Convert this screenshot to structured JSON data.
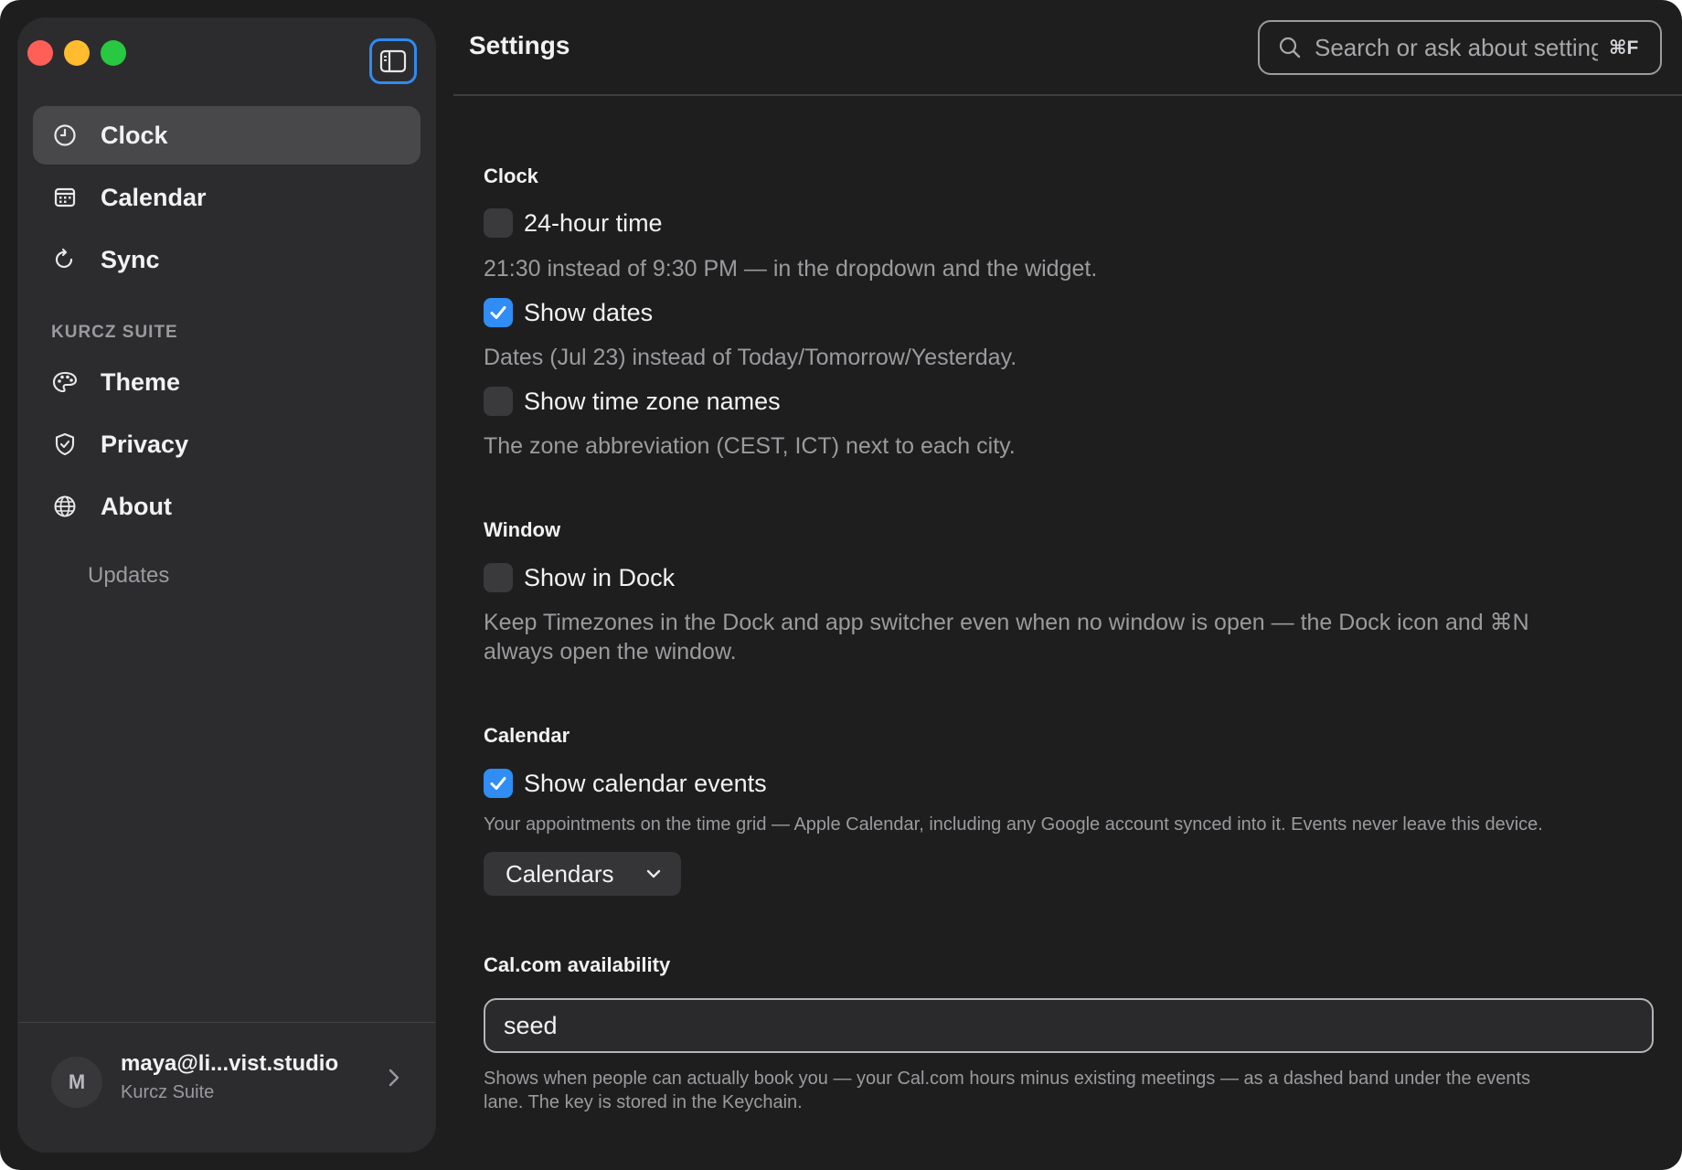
{
  "sidebar": {
    "nav": [
      {
        "label": "Clock",
        "icon": "clock-icon",
        "active": true
      },
      {
        "label": "Calendar",
        "icon": "calendar-icon",
        "active": false
      },
      {
        "label": "Sync",
        "icon": "sync-icon",
        "active": false
      }
    ],
    "section_label": "KURCZ SUITE",
    "suite_nav": [
      {
        "label": "Theme",
        "icon": "palette-icon"
      },
      {
        "label": "Privacy",
        "icon": "shield-check-icon"
      },
      {
        "label": "About",
        "icon": "globe-icon"
      }
    ],
    "sub_item": "Updates",
    "account": {
      "avatar_initial": "M",
      "email": "maya@li...vist.studio",
      "subtitle": "Kurcz Suite"
    }
  },
  "header": {
    "title": "Settings",
    "search_placeholder": "Search or ask about settings",
    "search_shortcut": "⌘F"
  },
  "clock": {
    "title": "Clock",
    "options": [
      {
        "label": "24-hour time",
        "checked": false,
        "description": "21:30 instead of 9:30 PM — in the dropdown and the widget."
      },
      {
        "label": "Show dates",
        "checked": true,
        "description": "Dates (Jul 23) instead of Today/Tomorrow/Yesterday."
      },
      {
        "label": "Show time zone names",
        "checked": false,
        "description": "The zone abbreviation (CEST, ICT) next to each city."
      }
    ]
  },
  "window": {
    "title": "Window",
    "options": [
      {
        "label": "Show in Dock",
        "checked": false,
        "description_line1": "Keep Timezones in the Dock and app switcher even when no window is open — the Dock icon and ⌘N",
        "description_line2": "always open the window."
      }
    ]
  },
  "calendar": {
    "title": "Calendar",
    "option": {
      "label": "Show calendar events",
      "checked": true,
      "description": "Your appointments on the time grid — Apple Calendar, including any Google account synced into it. Events never leave this device."
    },
    "dropdown_label": "Calendars"
  },
  "calcom": {
    "title": "Cal.com availability",
    "value": "seed",
    "description_line1": "Shows when people can actually book you — your Cal.com hours minus existing meetings — as a dashed band under the events",
    "description_line2": "lane. The key is stored in the Keychain."
  },
  "colors": {
    "accent": "#2f8df5",
    "window_bg": "#1e1e1e",
    "sidebar_bg": "#2c2c2e",
    "traffic_red": "#ff5f57",
    "traffic_yellow": "#febc2e",
    "traffic_green": "#28c840"
  }
}
